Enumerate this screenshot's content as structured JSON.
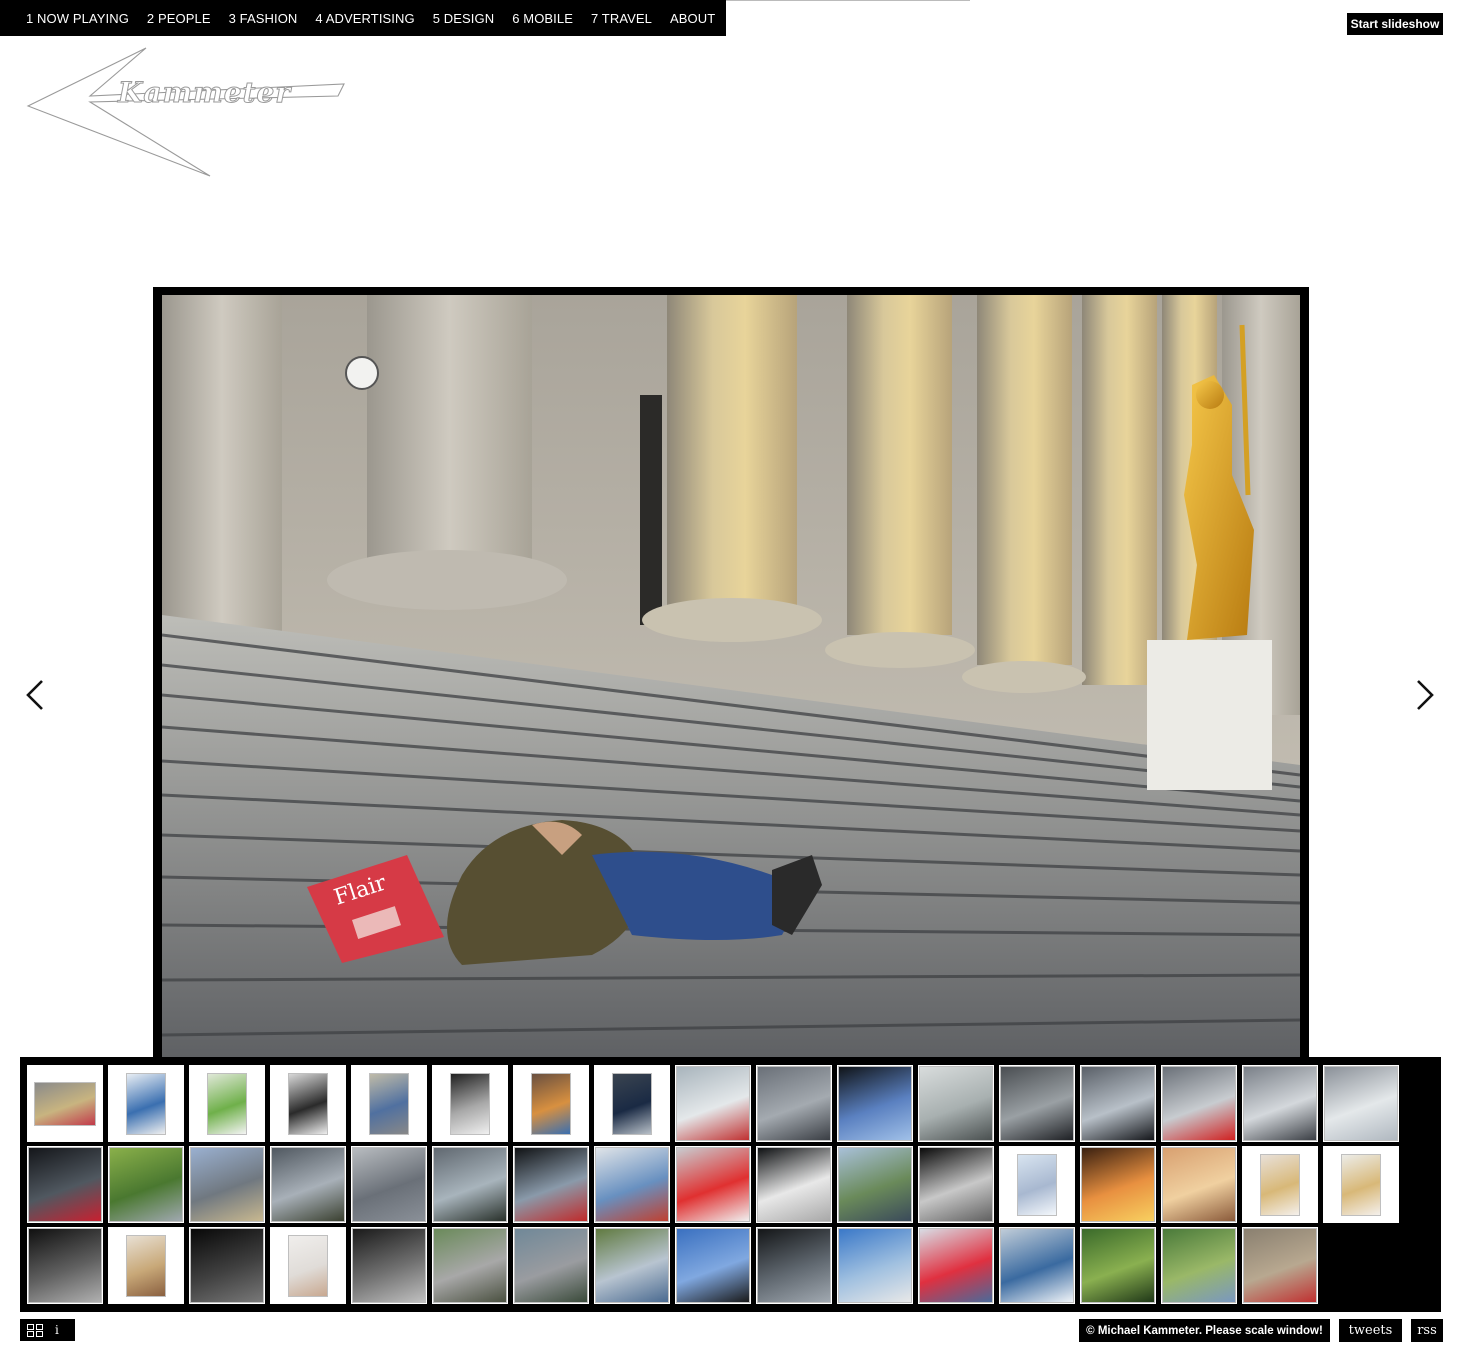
{
  "nav": {
    "items": [
      {
        "label": "1 NOW PLAYING"
      },
      {
        "label": "2 PEOPLE"
      },
      {
        "label": "3 FASHION"
      },
      {
        "label": "4 ADVERTISING"
      },
      {
        "label": "5 DESIGN"
      },
      {
        "label": "6 MOBILE"
      },
      {
        "label": "7 TRAVEL"
      },
      {
        "label": "ABOUT"
      }
    ]
  },
  "slideshow": {
    "label": "Start slideshow"
  },
  "logo": {
    "text": "Kammeter"
  },
  "main_image": {
    "magazine_text": "Flair"
  },
  "navigation": {
    "prev_icon": "chevron-left-icon",
    "next_icon": "chevron-right-icon"
  },
  "thumbnails": {
    "rows": [
      [
        {
          "kind": "landscape",
          "c1": "#8a8a8a",
          "c2": "#c8b480",
          "c3": "#c23a4a"
        },
        {
          "kind": "portrait",
          "c1": "#e8eef4",
          "c2": "#3a6fb0",
          "c3": "#f0f0f0"
        },
        {
          "kind": "portrait",
          "c1": "#e0e8d8",
          "c2": "#6fb04a",
          "c3": "#f4f4f4"
        },
        {
          "kind": "portrait",
          "c1": "#d8d8d8",
          "c2": "#2a2a2a",
          "c3": "#eeeeee"
        },
        {
          "kind": "portrait",
          "c1": "#c0bba8",
          "c2": "#5070a0",
          "c3": "#888888"
        },
        {
          "kind": "portrait",
          "c1": "#202020",
          "c2": "#a8a8a8",
          "c3": "#f0f0f0"
        },
        {
          "kind": "portrait",
          "c1": "#6a5040",
          "c2": "#d89040",
          "c3": "#3a6fb0"
        },
        {
          "kind": "portrait",
          "c1": "#3a4450",
          "c2": "#1a2a44",
          "c3": "#b8c0c8"
        },
        {
          "kind": "full",
          "c1": "#a8b4bc",
          "c2": "#e4e8ea",
          "c3": "#c03030"
        },
        {
          "kind": "full",
          "c1": "#6a7078",
          "c2": "#a4aab0",
          "c3": "#3a3e44"
        },
        {
          "kind": "full",
          "c1": "#101418",
          "c2": "#5a80c0",
          "c3": "#a0c0e8"
        },
        {
          "kind": "full",
          "c1": "#d8dcdc",
          "c2": "#a8b0b0",
          "c3": "#4a5050"
        },
        {
          "kind": "full",
          "c1": "#4a4e52",
          "c2": "#9aa0a4",
          "c3": "#1e2024"
        },
        {
          "kind": "full",
          "c1": "#5a6068",
          "c2": "#b8c0c8",
          "c3": "#14161a"
        },
        {
          "kind": "full",
          "c1": "#6a7078",
          "c2": "#c8ccd0",
          "c3": "#d02020"
        },
        {
          "kind": "full",
          "c1": "#7a8088",
          "c2": "#d4d8dc",
          "c3": "#3a3e44"
        },
        {
          "kind": "full",
          "c1": "#8a9098",
          "c2": "#e4e8ea",
          "c3": "#b0b8c0"
        }
      ],
      [
        {
          "kind": "full",
          "c1": "#14161a",
          "c2": "#505860",
          "c3": "#c82030"
        },
        {
          "kind": "full",
          "c1": "#8ab04a",
          "c2": "#4a7830",
          "c3": "#a0a8b0"
        },
        {
          "kind": "full",
          "c1": "#9ab0d0",
          "c2": "#707880",
          "c3": "#c8b890"
        },
        {
          "kind": "full",
          "c1": "#505860",
          "c2": "#a8b0b8",
          "c3": "#3a4030"
        },
        {
          "kind": "full",
          "c1": "#b8bcc0",
          "c2": "#6a7078",
          "c3": "#8a9098"
        },
        {
          "kind": "full",
          "c1": "#606870",
          "c2": "#a8b4bc",
          "c3": "#28302a"
        },
        {
          "kind": "full",
          "c1": "#101214",
          "c2": "#8a9aaa",
          "c3": "#c02a2a"
        },
        {
          "kind": "full",
          "c1": "#e0e4e8",
          "c2": "#6890c0",
          "c3": "#c04030"
        },
        {
          "kind": "full",
          "c1": "#c8ccd0",
          "c2": "#e03030",
          "c3": "#f0f0f0"
        },
        {
          "kind": "full",
          "c1": "#0e1012",
          "c2": "#e8e8e8",
          "c3": "#a8a8a8"
        },
        {
          "kind": "full",
          "c1": "#a8c0d8",
          "c2": "#6a8a5a",
          "c3": "#3a4a5a"
        },
        {
          "kind": "full",
          "c1": "#0a0a0a",
          "c2": "#c8c8c8",
          "c3": "#606060"
        },
        {
          "kind": "portrait",
          "c1": "#d8e4f0",
          "c2": "#a8b8d0",
          "c3": "#f4f8fc"
        },
        {
          "kind": "full",
          "c1": "#3a2010",
          "c2": "#e89040",
          "c3": "#f8d060"
        },
        {
          "kind": "full",
          "c1": "#d8a070",
          "c2": "#f0d0a0",
          "c3": "#8a5a3a"
        },
        {
          "kind": "portrait",
          "c1": "#e8e0d8",
          "c2": "#d8b878",
          "c3": "#f4f0ec"
        },
        {
          "kind": "portrait",
          "c1": "#ecece8",
          "c2": "#d8b878",
          "c3": "#f4f0ec"
        }
      ],
      [
        {
          "kind": "full",
          "c1": "#101010",
          "c2": "#606060",
          "c3": "#b0b0b0"
        },
        {
          "kind": "portrait",
          "c1": "#e8e0d4",
          "c2": "#c8a878",
          "c3": "#8a6040"
        },
        {
          "kind": "full",
          "c1": "#080808",
          "c2": "#404040",
          "c3": "#787878"
        },
        {
          "kind": "portrait",
          "c1": "#f0eeec",
          "c2": "#e0dcd8",
          "c3": "#c8a890"
        },
        {
          "kind": "full",
          "c1": "#1a1a1a",
          "c2": "#707070",
          "c3": "#c0c0c0"
        },
        {
          "kind": "full",
          "c1": "#6a8a5a",
          "c2": "#a8a8a8",
          "c3": "#4a5040"
        },
        {
          "kind": "full",
          "c1": "#708898",
          "c2": "#9a9ca0",
          "c3": "#3a4a3a"
        },
        {
          "kind": "full",
          "c1": "#607a40",
          "c2": "#b8c4d0",
          "c3": "#4a6a90"
        },
        {
          "kind": "full",
          "c1": "#3a70c0",
          "c2": "#80a8e0",
          "c3": "#1a1a1a"
        },
        {
          "kind": "full",
          "c1": "#141618",
          "c2": "#606870",
          "c3": "#a0a8b0"
        },
        {
          "kind": "full",
          "c1": "#3a78c8",
          "c2": "#a0c0e0",
          "c3": "#e8e8e8"
        },
        {
          "kind": "full",
          "c1": "#d8dce4",
          "c2": "#e03040",
          "c3": "#4a6a9a"
        },
        {
          "kind": "full",
          "c1": "#c0ccd8",
          "c2": "#3a6aa0",
          "c3": "#f0f4f8"
        },
        {
          "kind": "full",
          "c1": "#3a6a2a",
          "c2": "#8ab050",
          "c3": "#203818"
        },
        {
          "kind": "full",
          "c1": "#4a7a3a",
          "c2": "#9ab868",
          "c3": "#7a98c0"
        },
        {
          "kind": "full",
          "c1": "#8a8070",
          "c2": "#b8a890",
          "c3": "#c03030"
        }
      ]
    ]
  },
  "footer": {
    "grid_icon": "grid-icon",
    "info_label": "i",
    "copyright": "© Michael Kammeter. Please scale window!",
    "tweets": "tweets",
    "rss": "rss"
  }
}
